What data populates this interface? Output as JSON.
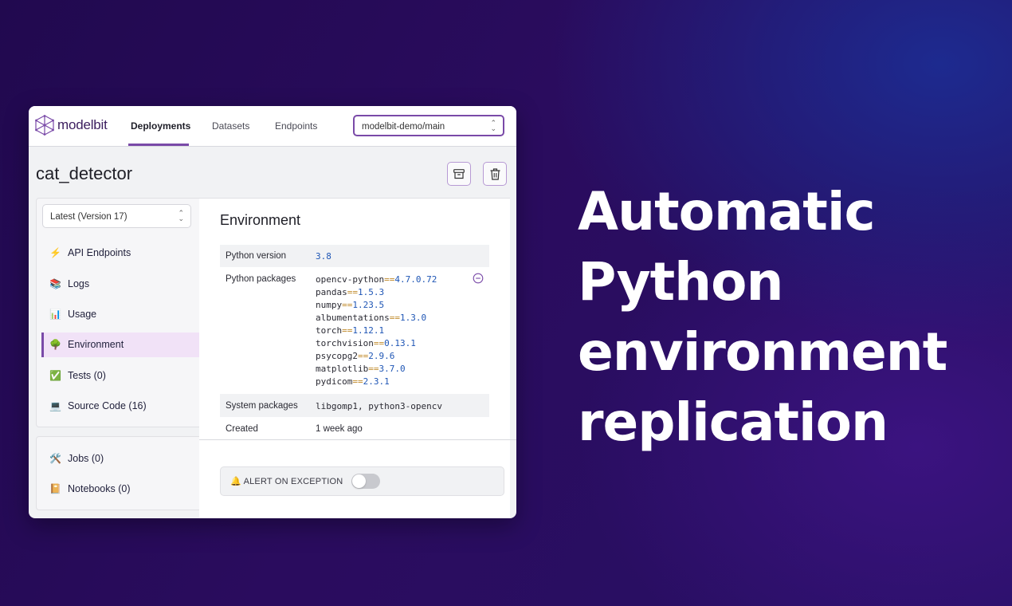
{
  "app": {
    "logo_text": "modelbit"
  },
  "nav": {
    "tabs": [
      {
        "label": "Deployments",
        "active": true
      },
      {
        "label": "Datasets",
        "active": false
      },
      {
        "label": "Endpoints",
        "active": false
      }
    ],
    "project_select": "modelbit-demo/main"
  },
  "deployment": {
    "title": "cat_detector"
  },
  "toolbar": {
    "archive_icon": "archive-icon",
    "delete_icon": "trash-icon"
  },
  "sidebar": {
    "version_select": "Latest (Version 17)",
    "items": [
      {
        "emoji": "⚡",
        "label": "API Endpoints"
      },
      {
        "emoji": "📚",
        "label": "Logs"
      },
      {
        "emoji": "📊",
        "label": "Usage"
      },
      {
        "emoji": "🌳",
        "label": "Environment",
        "active": true
      },
      {
        "emoji": "✅",
        "label": "Tests (0)"
      },
      {
        "emoji": "💻",
        "label": "Source Code (16)"
      }
    ],
    "items2": [
      {
        "emoji": "🛠️",
        "label": "Jobs (0)"
      },
      {
        "emoji": "📔",
        "label": "Notebooks (0)"
      }
    ]
  },
  "environment": {
    "title": "Environment",
    "python_version_label": "Python version",
    "python_version": "3.8",
    "python_packages_label": "Python packages",
    "packages": [
      {
        "name": "opencv-python",
        "op": "==",
        "version": "4.7.0.72"
      },
      {
        "name": "pandas",
        "op": "==",
        "version": "1.5.3"
      },
      {
        "name": "numpy",
        "op": "==",
        "version": "1.23.5"
      },
      {
        "name": "albumentations",
        "op": "==",
        "version": "1.3.0"
      },
      {
        "name": "torch",
        "op": "==",
        "version": "1.12.1"
      },
      {
        "name": "torchvision",
        "op": "==",
        "version": "0.13.1"
      },
      {
        "name": "psycopg2",
        "op": "==",
        "version": "2.9.6"
      },
      {
        "name": "matplotlib",
        "op": "==",
        "version": "3.7.0"
      },
      {
        "name": "pydicom",
        "op": "==",
        "version": "2.3.1"
      }
    ],
    "system_packages_label": "System packages",
    "system_packages": "libgomp1, python3-opencv",
    "created_label": "Created",
    "created": "1 week ago"
  },
  "alert": {
    "emoji": "🔔",
    "label": "ALERT ON EXCEPTION",
    "enabled": false
  },
  "headline": {
    "lines": [
      "Automatic",
      "Python",
      "environment",
      "replication"
    ]
  },
  "colors": {
    "accent": "#7a4aa8",
    "link_blue": "#1f56b5"
  }
}
